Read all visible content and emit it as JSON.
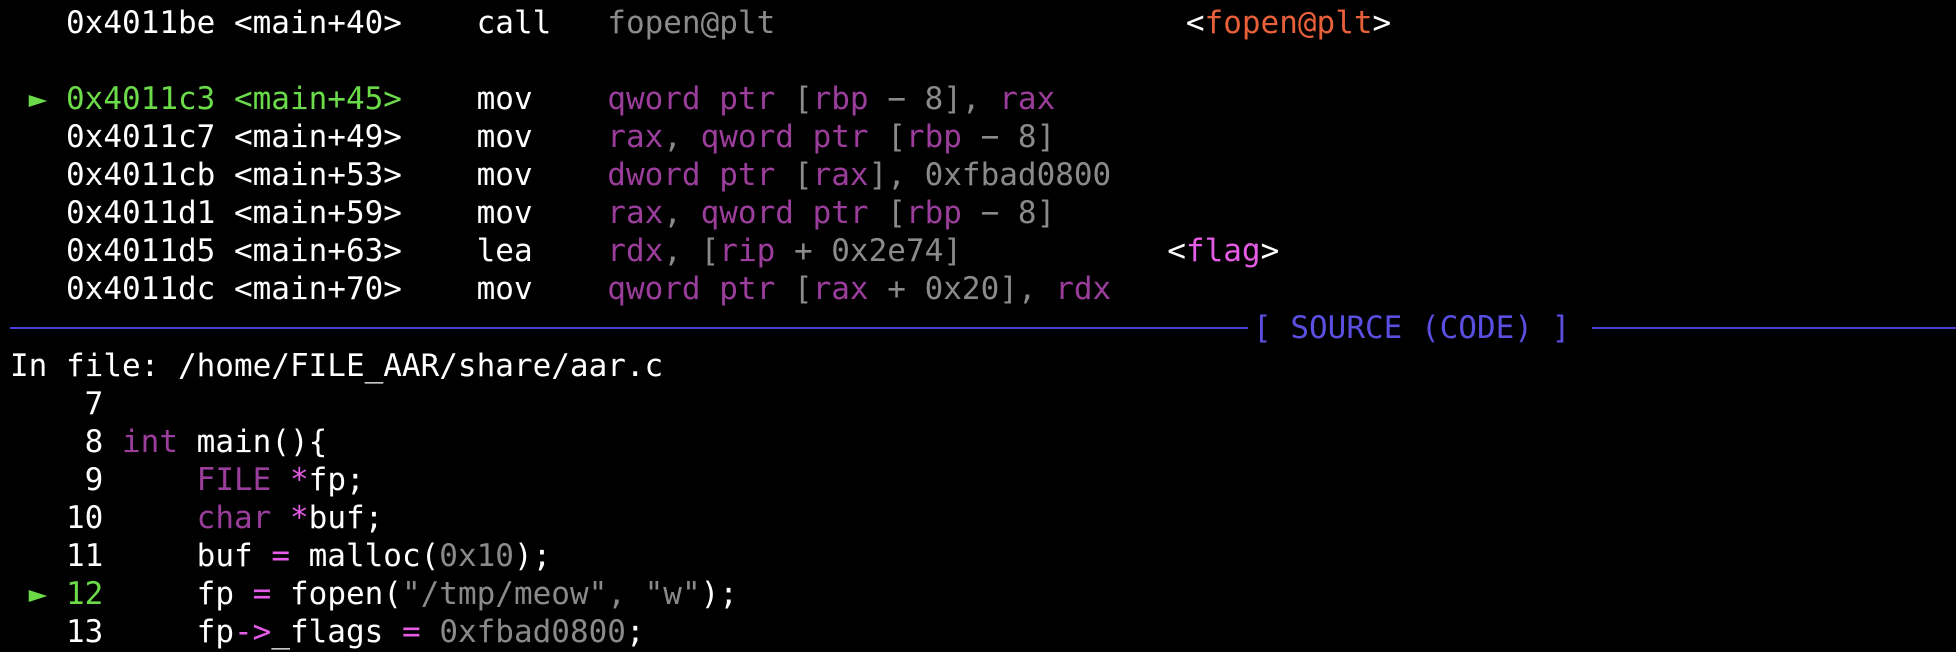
{
  "disasm": {
    "rows": [
      {
        "marker": "",
        "address": "0x4011be",
        "symbol": "<main+40>",
        "mnemonic": "call",
        "operands": [
          {
            "t": "fopen@plt",
            "c": "g"
          }
        ],
        "annotation": [
          {
            "t": "<",
            "c": "w"
          },
          {
            "t": "fopen@plt",
            "c": "o"
          },
          {
            "t": ">",
            "c": "w"
          }
        ],
        "current": false
      },
      {
        "marker": "►",
        "address": "0x4011c3",
        "symbol": "<main+45>",
        "mnemonic": "mov",
        "operands": [
          {
            "t": "qword ptr ",
            "c": "p"
          },
          {
            "t": "[",
            "c": "g"
          },
          {
            "t": "rbp",
            "c": "p"
          },
          {
            "t": " − 8], ",
            "c": "g"
          },
          {
            "t": "rax",
            "c": "p"
          }
        ],
        "annotation": [],
        "current": true
      },
      {
        "marker": "",
        "address": "0x4011c7",
        "symbol": "<main+49>",
        "mnemonic": "mov",
        "operands": [
          {
            "t": "rax",
            "c": "p"
          },
          {
            "t": ", ",
            "c": "g"
          },
          {
            "t": "qword ptr ",
            "c": "p"
          },
          {
            "t": "[",
            "c": "g"
          },
          {
            "t": "rbp",
            "c": "p"
          },
          {
            "t": " − 8]",
            "c": "g"
          }
        ],
        "annotation": [],
        "current": false
      },
      {
        "marker": "",
        "address": "0x4011cb",
        "symbol": "<main+53>",
        "mnemonic": "mov",
        "operands": [
          {
            "t": "dword ptr ",
            "c": "p"
          },
          {
            "t": "[",
            "c": "g"
          },
          {
            "t": "rax",
            "c": "p"
          },
          {
            "t": "], 0xfbad0800",
            "c": "g"
          }
        ],
        "annotation": [],
        "current": false
      },
      {
        "marker": "",
        "address": "0x4011d1",
        "symbol": "<main+59>",
        "mnemonic": "mov",
        "operands": [
          {
            "t": "rax",
            "c": "p"
          },
          {
            "t": ", ",
            "c": "g"
          },
          {
            "t": "qword ptr ",
            "c": "p"
          },
          {
            "t": "[",
            "c": "g"
          },
          {
            "t": "rbp",
            "c": "p"
          },
          {
            "t": " − 8]",
            "c": "g"
          }
        ],
        "annotation": [],
        "current": false
      },
      {
        "marker": "",
        "address": "0x4011d5",
        "symbol": "<main+63>",
        "mnemonic": "lea",
        "operands": [
          {
            "t": "rdx",
            "c": "p"
          },
          {
            "t": ", [",
            "c": "g"
          },
          {
            "t": "rip",
            "c": "p"
          },
          {
            "t": " + 0x2e74]",
            "c": "g"
          }
        ],
        "annotation": [
          {
            "t": "<",
            "c": "w"
          },
          {
            "t": "flag",
            "c": "m"
          },
          {
            "t": ">",
            "c": "w"
          }
        ],
        "current": false
      },
      {
        "marker": "",
        "address": "0x4011dc",
        "symbol": "<main+70>",
        "mnemonic": "mov",
        "operands": [
          {
            "t": "qword ptr ",
            "c": "p"
          },
          {
            "t": "[",
            "c": "g"
          },
          {
            "t": "rax",
            "c": "p"
          },
          {
            "t": " + 0x20], ",
            "c": "g"
          },
          {
            "t": "rdx",
            "c": "p"
          }
        ],
        "annotation": [],
        "current": false
      }
    ]
  },
  "source_header": "[ SOURCE (CODE) ]",
  "source": {
    "file_label": "In file: /home/FILE_AAR/share/aar.c",
    "lines": [
      {
        "marker": "",
        "num": "7",
        "code": [],
        "current": false
      },
      {
        "marker": "",
        "num": "8",
        "code": [
          {
            "t": "int",
            "c": "p"
          },
          {
            "t": " main(){",
            "c": "w"
          }
        ],
        "current": false
      },
      {
        "marker": "",
        "num": "9",
        "code": [
          {
            "t": "    ",
            "c": "w"
          },
          {
            "t": "FILE",
            "c": "p"
          },
          {
            "t": " ",
            "c": "w"
          },
          {
            "t": "*",
            "c": "m"
          },
          {
            "t": "fp;",
            "c": "w"
          }
        ],
        "current": false
      },
      {
        "marker": "",
        "num": "10",
        "code": [
          {
            "t": "    ",
            "c": "w"
          },
          {
            "t": "char",
            "c": "p"
          },
          {
            "t": " ",
            "c": "w"
          },
          {
            "t": "*",
            "c": "m"
          },
          {
            "t": "buf;",
            "c": "w"
          }
        ],
        "current": false
      },
      {
        "marker": "",
        "num": "11",
        "code": [
          {
            "t": "    buf ",
            "c": "w"
          },
          {
            "t": "=",
            "c": "m"
          },
          {
            "t": " malloc(",
            "c": "w"
          },
          {
            "t": "0x10",
            "c": "g"
          },
          {
            "t": ");",
            "c": "w"
          }
        ],
        "current": false
      },
      {
        "marker": "►",
        "num": "12",
        "code": [
          {
            "t": "    fp ",
            "c": "w"
          },
          {
            "t": "=",
            "c": "m"
          },
          {
            "t": " fopen(",
            "c": "w"
          },
          {
            "t": "\"/tmp/meow\", \"w\"",
            "c": "g"
          },
          {
            "t": ");",
            "c": "w"
          }
        ],
        "current": true
      },
      {
        "marker": "",
        "num": "13",
        "code": [
          {
            "t": "    fp",
            "c": "w"
          },
          {
            "t": "->",
            "c": "m"
          },
          {
            "t": "_flags ",
            "c": "w"
          },
          {
            "t": "=",
            "c": "m"
          },
          {
            "t": " ",
            "c": "w"
          },
          {
            "t": "0xfbad0800",
            "c": "g"
          },
          {
            "t": ";",
            "c": "w"
          }
        ],
        "current": false
      }
    ]
  },
  "colors": {
    "background": "#000000",
    "current_line": "#6cdb4a",
    "separator": "#4a3fd6",
    "keyword": "#9b3d9b",
    "operator": "#e65ce6",
    "plt_symbol": "#e8603a",
    "dim": "#8a8a8a"
  }
}
